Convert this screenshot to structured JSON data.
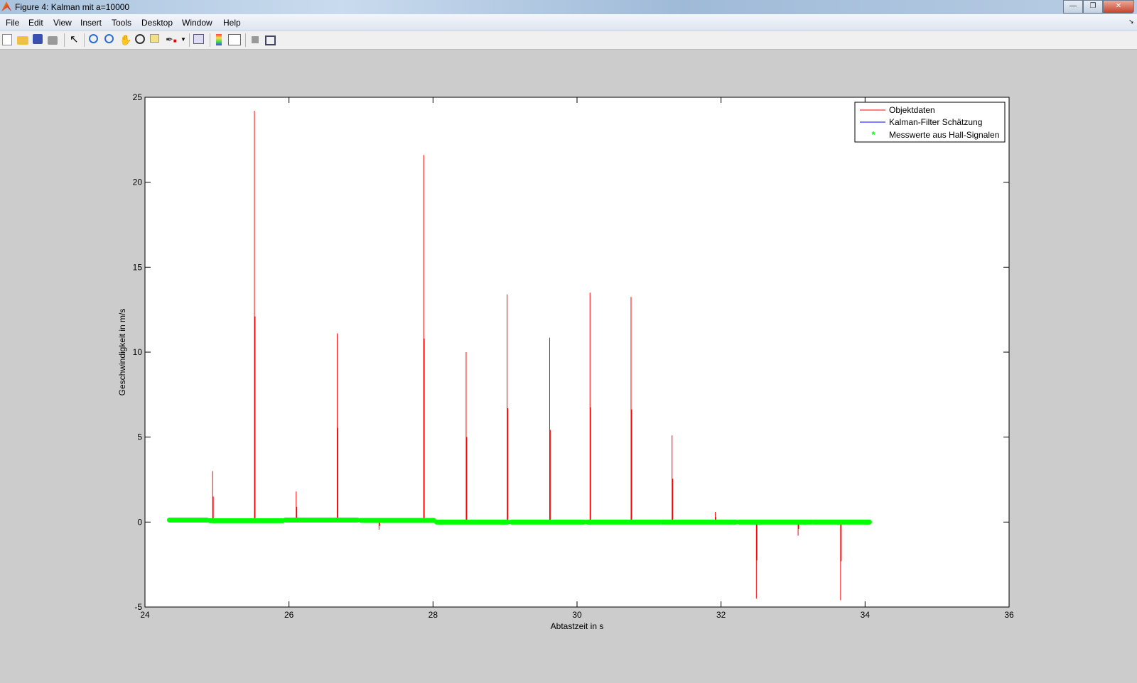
{
  "window": {
    "title": "Figure 4: Kalman mit a=10000",
    "buttons": [
      "minimize",
      "maximize",
      "close"
    ]
  },
  "menu": [
    "File",
    "Edit",
    "View",
    "Insert",
    "Tools",
    "Desktop",
    "Window",
    "Help"
  ],
  "toolbar": [
    "new-figure-icon",
    "open-file-icon",
    "save-icon",
    "print-icon",
    "pointer-icon",
    "zoom-in-icon",
    "zoom-out-icon",
    "pan-icon",
    "rotate-3d-icon",
    "data-cursor-icon",
    "brush-icon",
    "link-plot-icon",
    "colorbar-icon",
    "legend-icon",
    "hide-plot-tools-icon",
    "show-plot-tools-icon"
  ],
  "colors": {
    "red": "#ff0000",
    "blue": "#0000ff",
    "green": "#00ff00"
  },
  "chart_data": {
    "type": "line",
    "xlabel": "Abtastzeit in s",
    "ylabel": "Geschwindigkeit in m/s",
    "xlim": [
      24,
      36
    ],
    "ylim": [
      -5,
      25
    ],
    "xticks": [
      "24",
      "26",
      "28",
      "30",
      "32",
      "34",
      "36"
    ],
    "yticks": [
      "-5",
      "0",
      "5",
      "10",
      "15",
      "20",
      "25"
    ],
    "legend_position": "top-right",
    "legend": [
      "Objektdaten",
      "Kalman-Filter Schätzung",
      "Messwerte aus Hall-Signalen"
    ],
    "objektdaten_spikes": [
      {
        "x": 24.94,
        "y": 3.0
      },
      {
        "x": 25.52,
        "y": 24.2
      },
      {
        "x": 26.1,
        "y": 1.8
      },
      {
        "x": 26.67,
        "y": 11.1
      },
      {
        "x": 27.25,
        "y": -0.45
      },
      {
        "x": 27.87,
        "y": 21.6
      },
      {
        "x": 28.46,
        "y": 10.0
      },
      {
        "x": 29.03,
        "y": 13.4
      },
      {
        "x": 29.62,
        "y": 10.85
      },
      {
        "x": 30.18,
        "y": 13.5
      },
      {
        "x": 30.75,
        "y": 13.25
      },
      {
        "x": 31.32,
        "y": 5.1
      },
      {
        "x": 31.92,
        "y": 0.6
      },
      {
        "x": 32.49,
        "y": -4.5
      },
      {
        "x": 33.07,
        "y": -0.8
      },
      {
        "x": 33.66,
        "y": -4.6
      }
    ],
    "hall_segments": [
      {
        "x0": 24.34,
        "x1": 24.86,
        "y": 0.12
      },
      {
        "x0": 24.9,
        "x1": 25.91,
        "y": 0.08
      },
      {
        "x0": 25.95,
        "x1": 26.95,
        "y": 0.12
      },
      {
        "x0": 27.0,
        "x1": 28.01,
        "y": 0.1
      },
      {
        "x0": 28.05,
        "x1": 29.04,
        "y": 0.0
      },
      {
        "x0": 29.09,
        "x1": 30.1,
        "y": 0.0
      },
      {
        "x0": 30.14,
        "x1": 31.15,
        "y": 0.0
      },
      {
        "x0": 31.18,
        "x1": 32.21,
        "y": 0.0
      },
      {
        "x0": 32.25,
        "x1": 33.26,
        "y": 0.0
      },
      {
        "x0": 33.29,
        "x1": 34.06,
        "y": 0.0
      }
    ]
  }
}
